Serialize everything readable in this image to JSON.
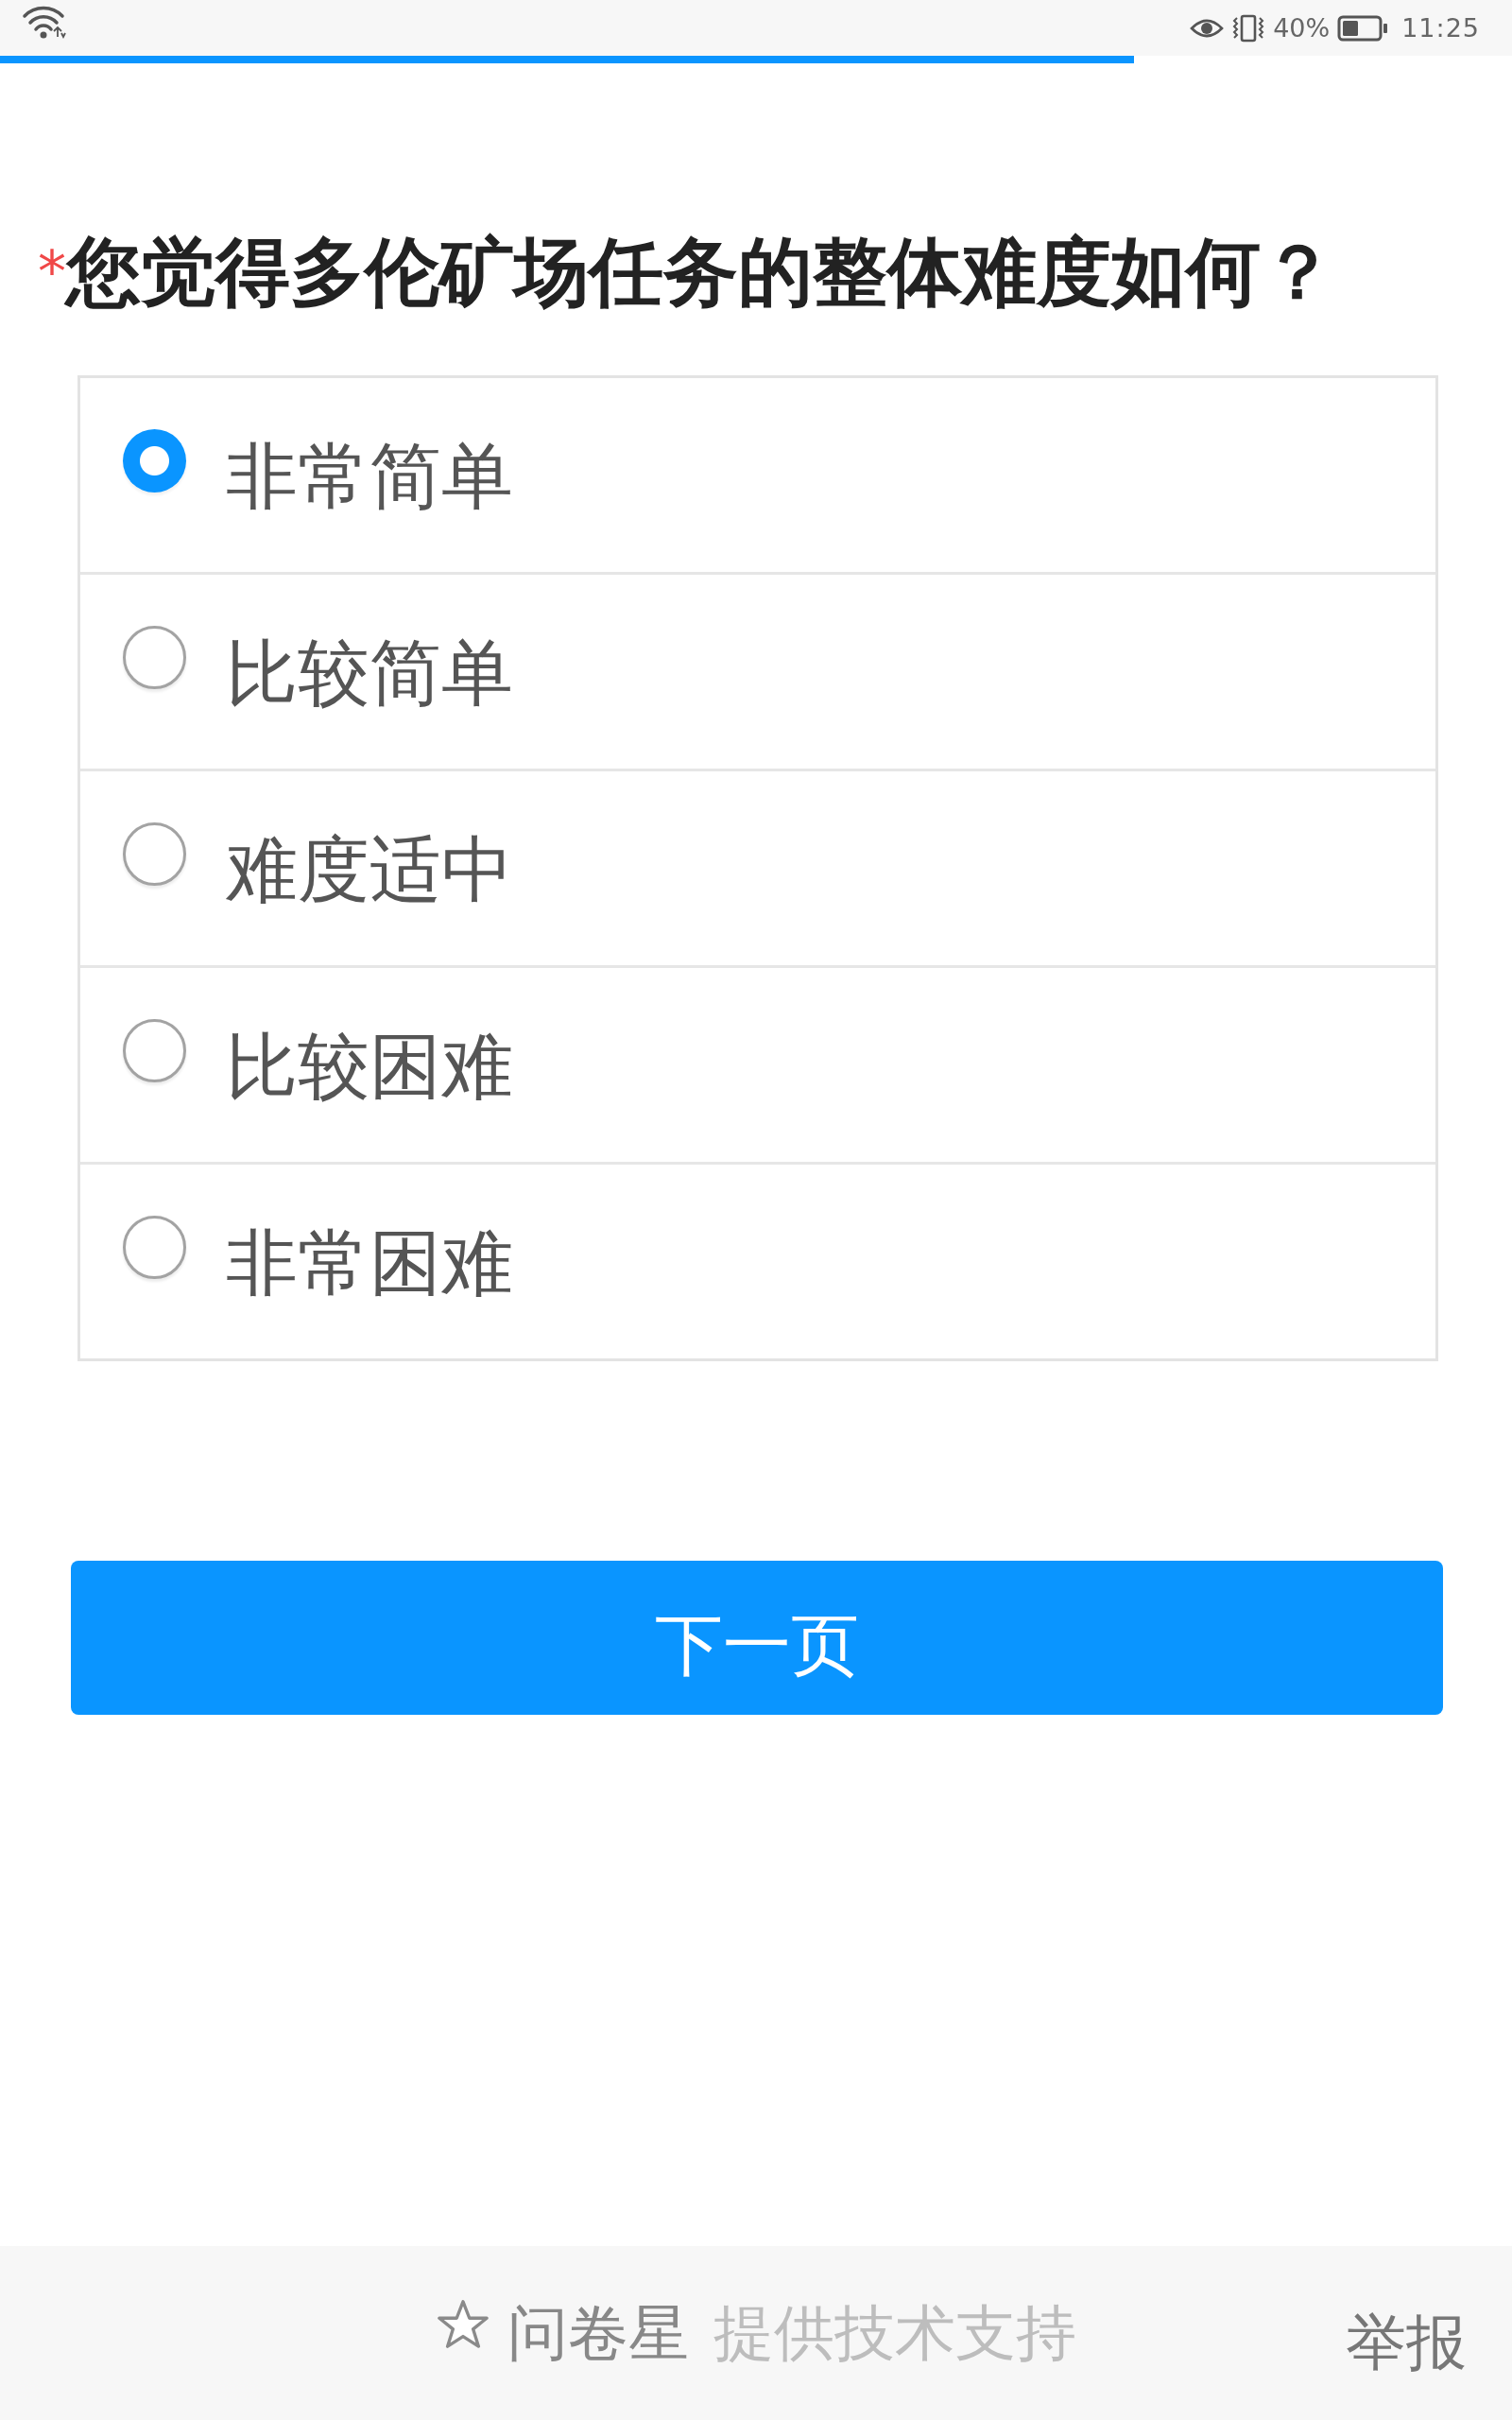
{
  "status_bar": {
    "battery_percent": "40%",
    "time": "11:25"
  },
  "progress": {
    "level": 0.75
  },
  "question": {
    "required_mark": "*",
    "title": "您觉得多伦矿场任务的整体难度如何？"
  },
  "options": [
    {
      "label": "非常简单",
      "selected": true
    },
    {
      "label": "比较简单",
      "selected": false
    },
    {
      "label": "难度适中",
      "selected": false
    },
    {
      "label": "比较困难",
      "selected": false
    },
    {
      "label": "非常困难",
      "selected": false
    }
  ],
  "next_button": {
    "label": "下一页"
  },
  "footer": {
    "brand": "问卷星",
    "credit": "提供技术支持",
    "report_link": "举报"
  }
}
